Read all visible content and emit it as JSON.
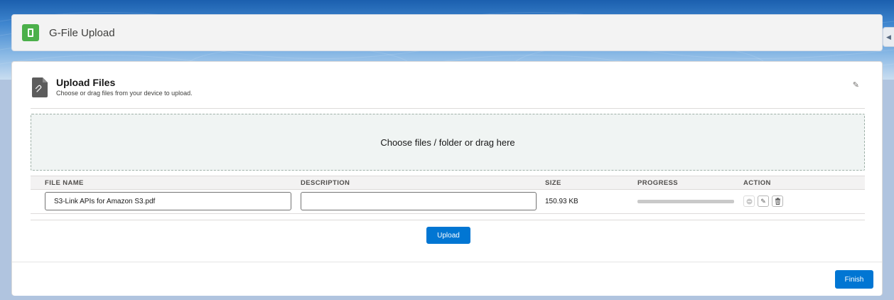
{
  "header": {
    "title": "G-File Upload",
    "app_icon": "mobile-device-icon",
    "accent": "#4bb04a"
  },
  "card": {
    "title": "Upload Files",
    "subtitle": "Choose or drag files from your device to upload.",
    "doc_icon": "attachment-file-icon",
    "edit_icon": "pencil-icon"
  },
  "dropzone": {
    "label": "Choose files / folder or drag here"
  },
  "table": {
    "columns": {
      "file_name": "FILE NAME",
      "description": "DESCRIPTION",
      "size": "SIZE",
      "progress": "PROGRESS",
      "action": "ACTION"
    },
    "rows": [
      {
        "file_name": "S3-Link APIs for Amazon S3.pdf",
        "description": "",
        "size": "150.93 KB",
        "progress_percent": 100,
        "actions": [
          "cancel-icon",
          "edit-icon",
          "delete-icon"
        ]
      }
    ]
  },
  "buttons": {
    "upload": "Upload",
    "finish": "Finish"
  },
  "colors": {
    "brand_blue": "#0176d3",
    "dropzone_bg": "#f0f4f3"
  }
}
